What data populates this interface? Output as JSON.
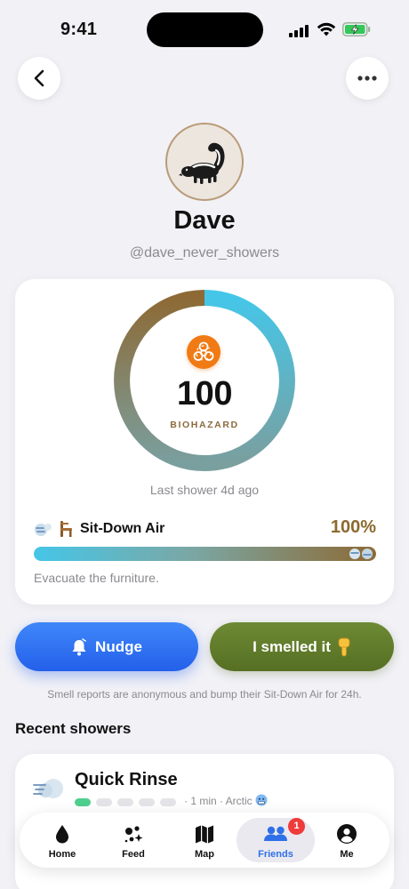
{
  "status_bar": {
    "time": "9:41"
  },
  "nav": {
    "back_icon": "chevron-left-icon",
    "more_icon": "ellipsis-icon"
  },
  "profile": {
    "avatar_icon": "skunk-icon",
    "name": "Dave",
    "handle": "@dave_never_showers"
  },
  "stink_card": {
    "score": "100",
    "score_label": "BIOHAZARD",
    "ring_fill_fraction": 1.0,
    "status_icon": "biohazard-icon",
    "last_shower": "Last shower 4d ago",
    "level_icons": [
      "wind-icon",
      "chair-icon"
    ],
    "level_name": "Sit-Down Air",
    "level_percent": "100%",
    "level_fraction": 1.0,
    "level_description": "Evacuate the furniture."
  },
  "actions": {
    "nudge_label": "Nudge",
    "nudge_icon": "bell-icon",
    "smelled_label": "I smelled it",
    "smelled_icon": "pointing-down-icon",
    "disclaimer": "Smell reports are anonymous and bump their Sit-Down Air for 24h."
  },
  "recent": {
    "section_title": "Recent showers",
    "items": [
      {
        "icon": "wind-puff-icon",
        "title": "Quick Rinse",
        "soap_total": 5,
        "soap_filled": 1,
        "meta": "· 1 min · Arctic",
        "meta_icon": "cold-face-icon"
      }
    ]
  },
  "tab_bar": {
    "tabs": [
      {
        "label": "Home",
        "icon": "drop-icon",
        "active": false
      },
      {
        "label": "Feed",
        "icon": "sparkles-icon",
        "active": false
      },
      {
        "label": "Map",
        "icon": "map-icon",
        "active": false
      },
      {
        "label": "Friends",
        "icon": "friends-icon",
        "active": true,
        "badge": "1"
      },
      {
        "label": "Me",
        "icon": "person-icon",
        "active": false
      }
    ]
  },
  "colors": {
    "nudge": "#2f6ff2",
    "smelled": "#5f7a2b",
    "ring_start": "#45c6e8",
    "ring_end": "#8d6a35",
    "active_tab": "#2f6fe8",
    "badge": "#ee3b3b"
  }
}
